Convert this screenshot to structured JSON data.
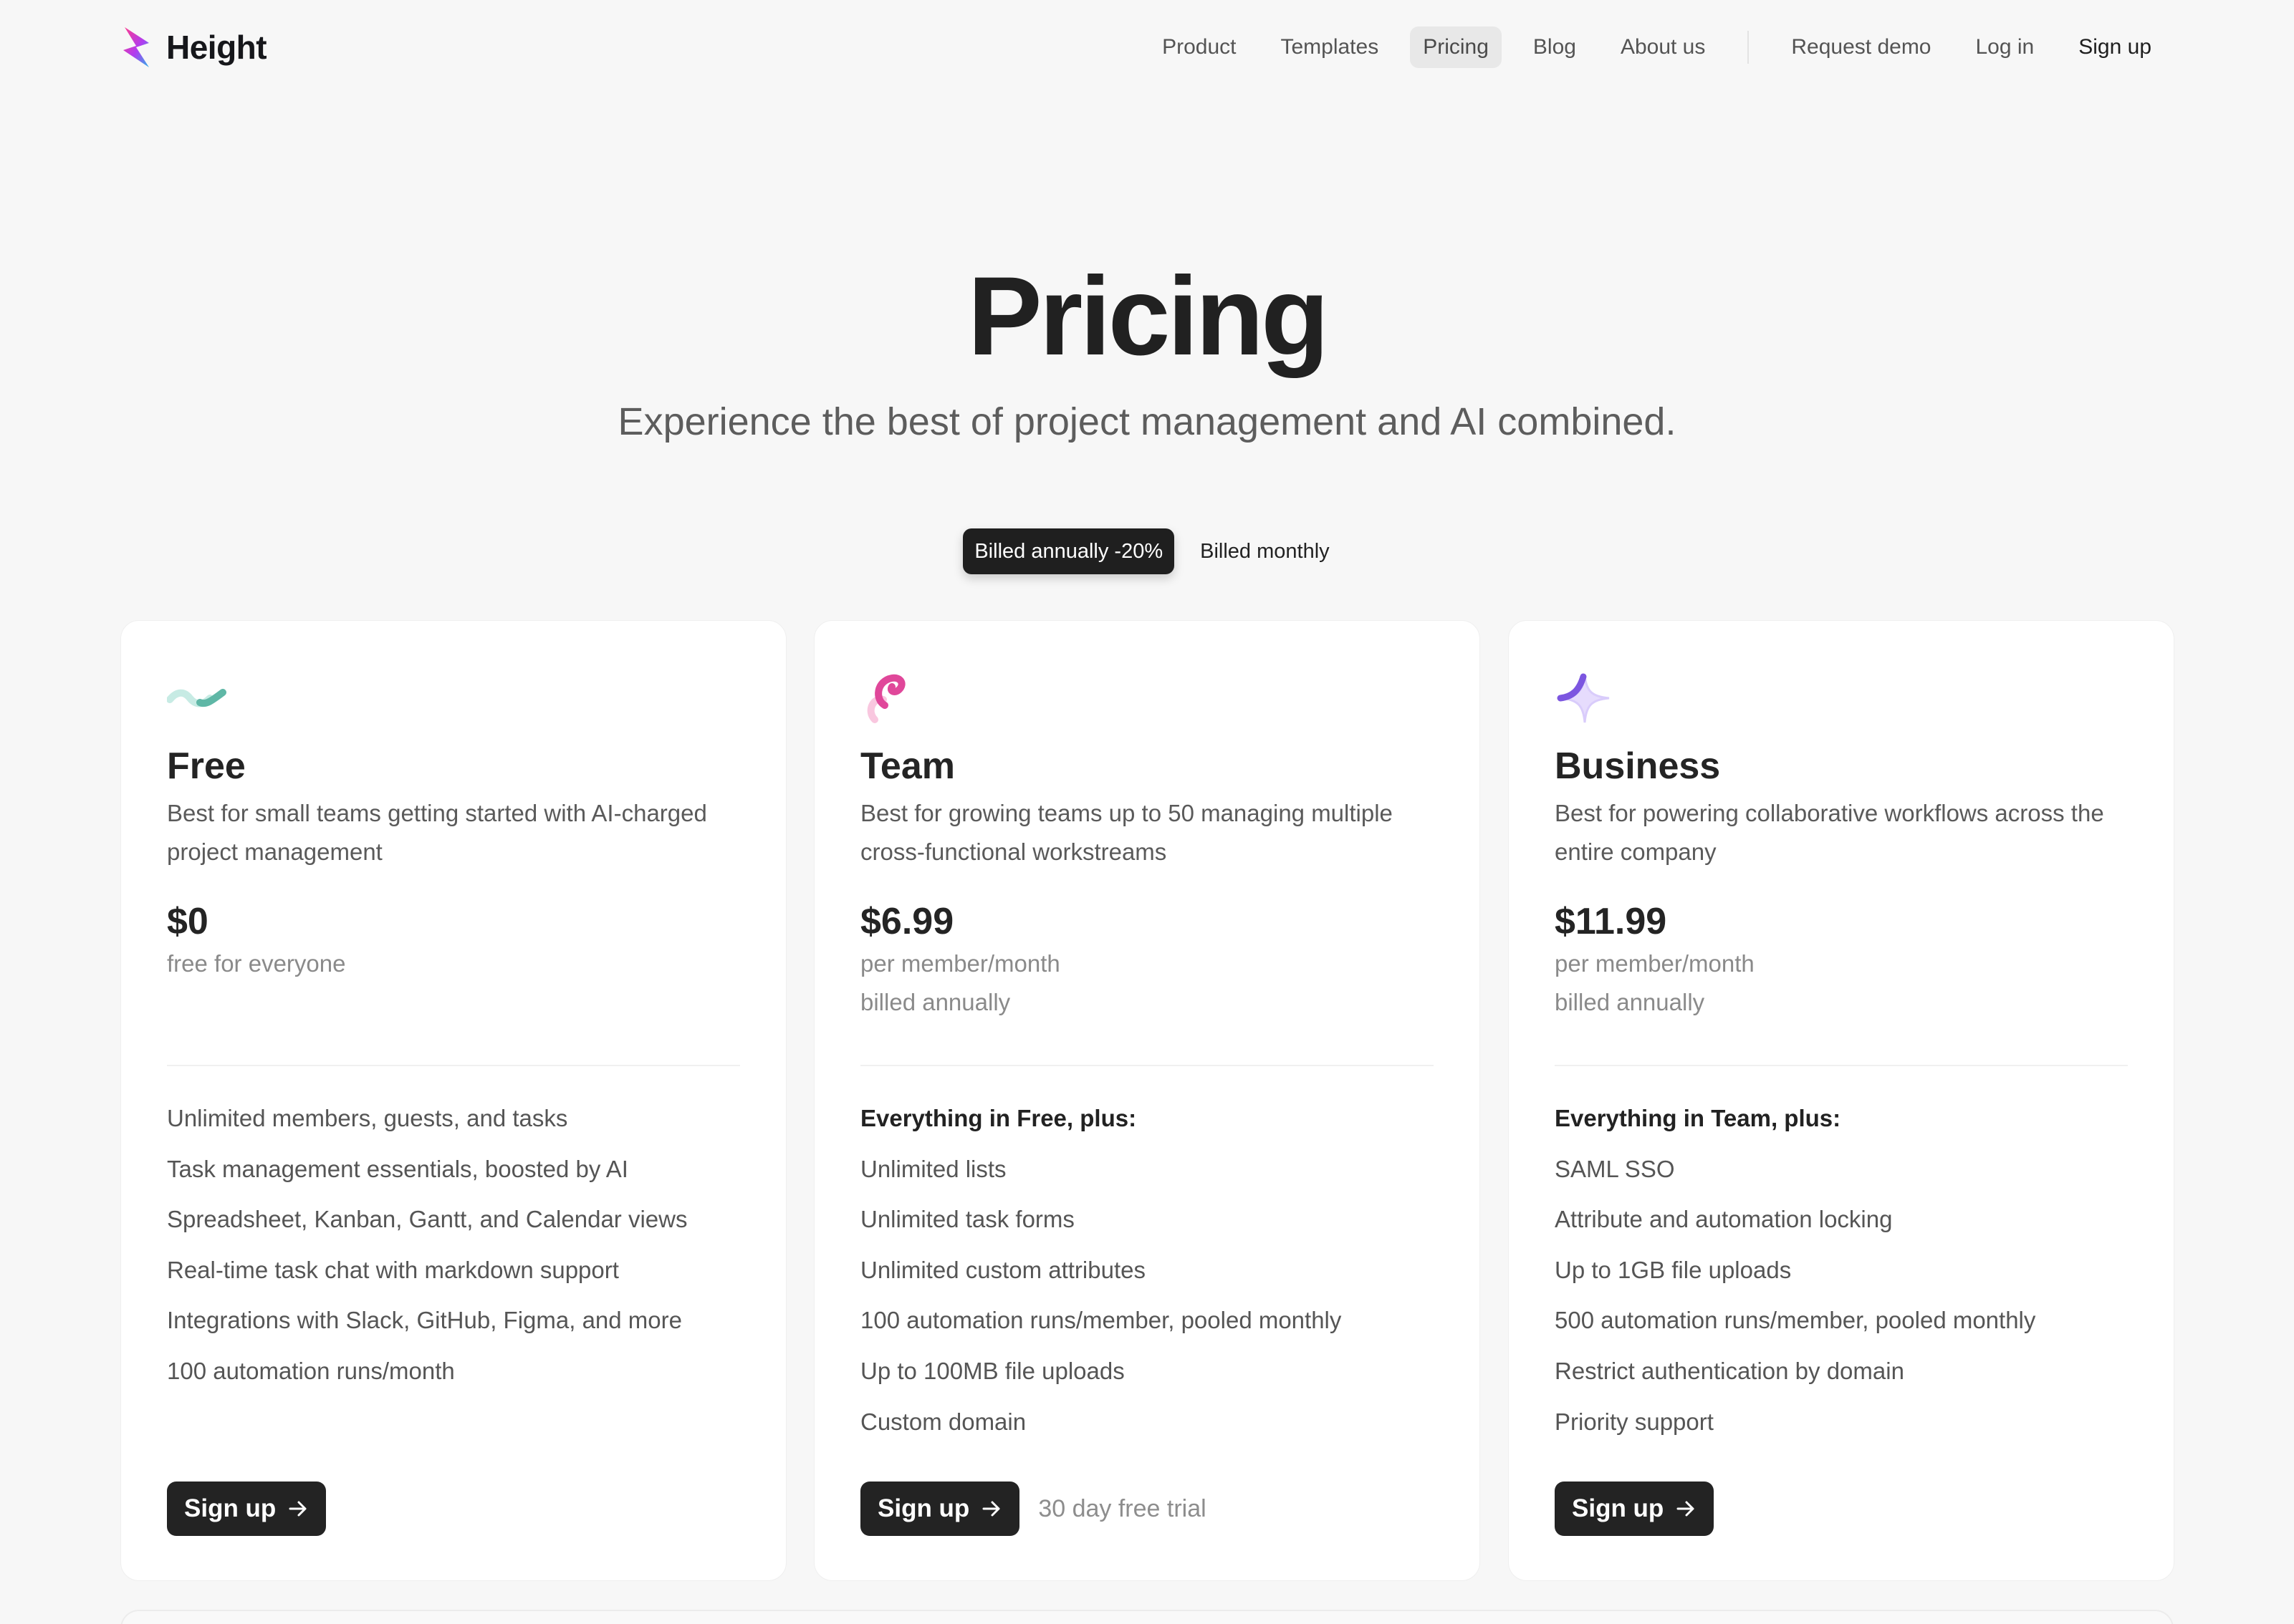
{
  "brand": {
    "name": "Height"
  },
  "nav": {
    "items": [
      {
        "label": "Product",
        "active": false
      },
      {
        "label": "Templates",
        "active": false
      },
      {
        "label": "Pricing",
        "active": true
      },
      {
        "label": "Blog",
        "active": false
      },
      {
        "label": "About us",
        "active": false
      }
    ],
    "request_demo": "Request demo",
    "login": "Log in",
    "signup": "Sign up"
  },
  "hero": {
    "title": "Pricing",
    "subtitle": "Experience the best of project management and AI combined."
  },
  "billing": {
    "annual_label": "Billed annually -20%",
    "monthly_label": "Billed monthly",
    "selected": "annual"
  },
  "plans": [
    {
      "icon": "wave-icon",
      "icon_colors": [
        "#c7ebe4",
        "#5fb7a6"
      ],
      "name": "Free",
      "description": "Best for small teams getting started with AI-charged project management",
      "price": "$0",
      "note": "free for everyone",
      "features_heading": "",
      "features": [
        "Unlimited members, guests, and tasks",
        "Task management essentials, boosted by AI",
        "Spreadsheet, Kanban, Gantt, and Calendar views",
        "Real-time task chat with markdown support",
        "Integrations with Slack, GitHub, Figma, and more",
        "100 automation runs/month"
      ],
      "cta": "Sign up",
      "cta_note": ""
    },
    {
      "icon": "swirl-icon",
      "icon_colors": [
        "#f9c7df",
        "#e0479a"
      ],
      "name": "Team",
      "description": "Best for growing teams up to 50 managing multiple cross-functional workstreams",
      "price": "$6.99",
      "note": "per member/month\nbilled annually",
      "features_heading": "Everything in Free, plus:",
      "features": [
        "Unlimited lists",
        "Unlimited task forms",
        "Unlimited custom attributes",
        "100 automation runs/member, pooled monthly",
        "Up to 100MB file uploads",
        "Custom domain"
      ],
      "cta": "Sign up",
      "cta_note": "30 day free trial"
    },
    {
      "icon": "sparkle-icon",
      "icon_colors": [
        "#d9ccfb",
        "#7c56e0"
      ],
      "name": "Business",
      "description": "Best for powering collaborative workflows across the entire company",
      "price": "$11.99",
      "note": "per member/month\nbilled annually",
      "features_heading": "Everything in Team, plus:",
      "features": [
        "SAML SSO",
        "Attribute and automation locking",
        "Up to 1GB file uploads",
        "500 automation runs/member, pooled monthly",
        "Restrict authentication by domain",
        "Priority support"
      ],
      "cta": "Sign up",
      "cta_note": ""
    }
  ]
}
